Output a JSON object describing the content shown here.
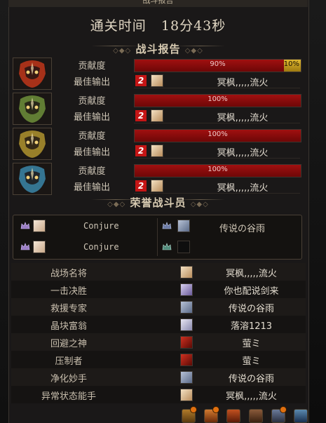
{
  "window": {
    "title": "战斗报告"
  },
  "clear_time": {
    "label": "通关时间",
    "value": "18分43秒"
  },
  "battle_report": {
    "heading": "战斗报告",
    "contribution_label": "贡献度",
    "best_output_label": "最佳输出",
    "rows": [
      {
        "emblem_icon": "fire-mask-emblem-icon",
        "emblem_color": "#c0361a",
        "contribution_percent": 90,
        "contribution_text": "90%",
        "bonus_percent": 10,
        "bonus_text": "10%",
        "best_rank": "2",
        "best_name": "冥枫,,,,,流火"
      },
      {
        "emblem_icon": "green-mask-emblem-icon",
        "emblem_color": "#6f8f3a",
        "contribution_percent": 100,
        "contribution_text": "100%",
        "best_rank": "2",
        "best_name": "冥枫,,,,,流火"
      },
      {
        "emblem_icon": "gold-mask-emblem-icon",
        "emblem_color": "#b0932e",
        "contribution_percent": 100,
        "contribution_text": "100%",
        "best_rank": "2",
        "best_name": "冥枫,,,,,流火"
      },
      {
        "emblem_icon": "blue-mask-emblem-icon",
        "emblem_color": "#3b86a8",
        "contribution_percent": 100,
        "contribution_text": "100%",
        "best_rank": "2",
        "best_name": "冥枫,,,,,流火"
      }
    ]
  },
  "honor": {
    "heading": "荣誉战斗员",
    "members": [
      {
        "name": "Conjure",
        "crown_icon": "crown-icon"
      },
      {
        "name": "传说の谷雨",
        "crown_icon": "crown-icon"
      },
      {
        "name": "Conjure",
        "crown_icon": "crown-icon"
      },
      {
        "name": "",
        "crown_icon": "crown-icon"
      }
    ]
  },
  "awards": [
    {
      "title": "战场名将",
      "player": "冥枫,,,,,流火"
    },
    {
      "title": "一击决胜",
      "player": "你也配说剑来"
    },
    {
      "title": "救援专家",
      "player": "传说の谷雨"
    },
    {
      "title": "晶块富翁",
      "player": "落溶1213"
    },
    {
      "title": "回避之神",
      "player": "萤ミ"
    },
    {
      "title": "压制者",
      "player": "萤ミ"
    },
    {
      "title": "净化妙手",
      "player": "传说の谷雨"
    },
    {
      "title": "异常状态能手",
      "player": "冥枫,,,,,流火"
    }
  ],
  "colors": {
    "contribution_bar": "#9e0f0f",
    "bonus_bar": "#d4a92a",
    "rank_badge": "#c41515"
  },
  "taskbar_icons": [
    "bag-icon",
    "sword-icon",
    "chest-icon",
    "inventory-icon",
    "character-icon",
    "shield-icon"
  ]
}
